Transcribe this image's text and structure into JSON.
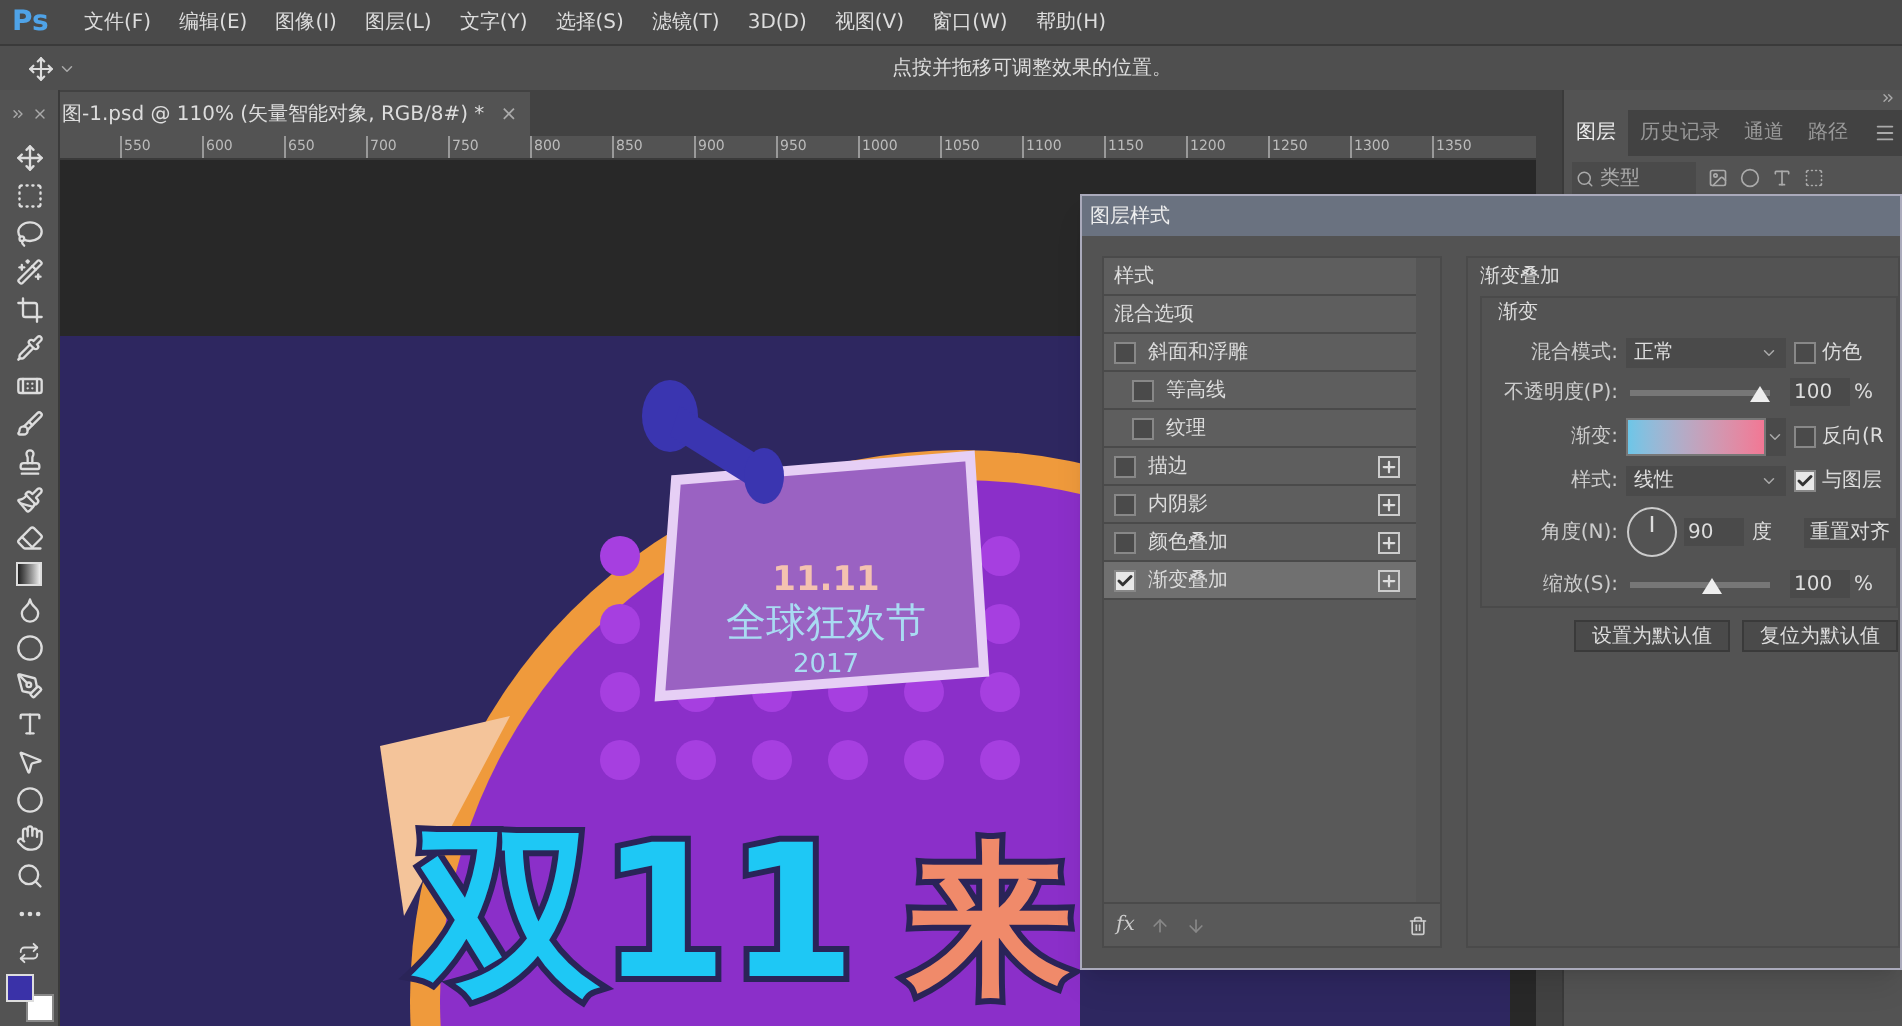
{
  "app_logo": "Ps",
  "menu": [
    "文件(F)",
    "编辑(E)",
    "图像(I)",
    "图层(L)",
    "文字(Y)",
    "选择(S)",
    "滤镜(T)",
    "3D(D)",
    "视图(V)",
    "窗口(W)",
    "帮助(H)"
  ],
  "options_bar": {
    "hint": "点按并拖移可调整效果的位置。"
  },
  "document_tab": {
    "title": "图-1.psd @ 110% (矢量智能对象, RGB/8#) *",
    "close": "×"
  },
  "ruler": {
    "ticks": [
      "550",
      "600",
      "650",
      "700",
      "750",
      "800",
      "850",
      "900",
      "950",
      "1000",
      "1050",
      "1100",
      "1150",
      "1200",
      "1250",
      "1300",
      "1350"
    ]
  },
  "artwork": {
    "badge_texts": [
      "11.11",
      "全球狂欢节",
      "2017"
    ],
    "headline": [
      {
        "text": "双11",
        "color": "#1ec8f5"
      },
      {
        "text": "来",
        "color": "#f08a6a"
      }
    ]
  },
  "layers_panel": {
    "tabs": [
      {
        "label": "图层",
        "selected": true
      },
      {
        "label": "历史记录",
        "selected": false
      },
      {
        "label": "通道",
        "selected": false
      },
      {
        "label": "路径",
        "selected": false
      }
    ],
    "filter_kind": "类型"
  },
  "dialog": {
    "title": "图层样式",
    "fx_label": "fx",
    "styles": [
      {
        "label": "样式",
        "kind": "title",
        "selected": false
      },
      {
        "label": "混合选项",
        "kind": "option",
        "selected": false
      },
      {
        "label": "斜面和浮雕",
        "kind": "effect",
        "checked": false,
        "selected": false,
        "children": [
          {
            "label": "等高线",
            "kind": "effect",
            "checked": false,
            "selected": false
          },
          {
            "label": "纹理",
            "kind": "effect",
            "checked": false,
            "selected": false
          }
        ]
      },
      {
        "label": "描边",
        "kind": "stackable",
        "checked": false,
        "selected": false
      },
      {
        "label": "内阴影",
        "kind": "stackable",
        "checked": false,
        "selected": false
      },
      {
        "label": "颜色叠加",
        "kind": "stackable",
        "checked": false,
        "selected": false
      },
      {
        "label": "渐变叠加",
        "kind": "stackable",
        "checked": true,
        "selected": true
      }
    ],
    "settings": {
      "section": "渐变叠加",
      "group": "渐变",
      "blend_mode": {
        "label": "混合模式:",
        "value": "正常"
      },
      "dither": {
        "label": "仿色",
        "checked": false
      },
      "opacity": {
        "label": "不透明度(P):",
        "level": 1,
        "value": "100",
        "unit": "%"
      },
      "gradient": {
        "label": "渐变:"
      },
      "reverse": {
        "label": "反向(R",
        "checked": false
      },
      "style": {
        "label": "样式:",
        "value": "线性"
      },
      "align": {
        "label": "与图层",
        "checked": true
      },
      "angle": {
        "label": "角度(N):",
        "value": "90",
        "unit": "度"
      },
      "reset_align": "重置对齐",
      "scale": {
        "label": "缩放(S):",
        "level": 0.6,
        "value": "100",
        "unit": "%"
      },
      "buttons": [
        "设置为默认值",
        "复位为默认值"
      ]
    }
  }
}
